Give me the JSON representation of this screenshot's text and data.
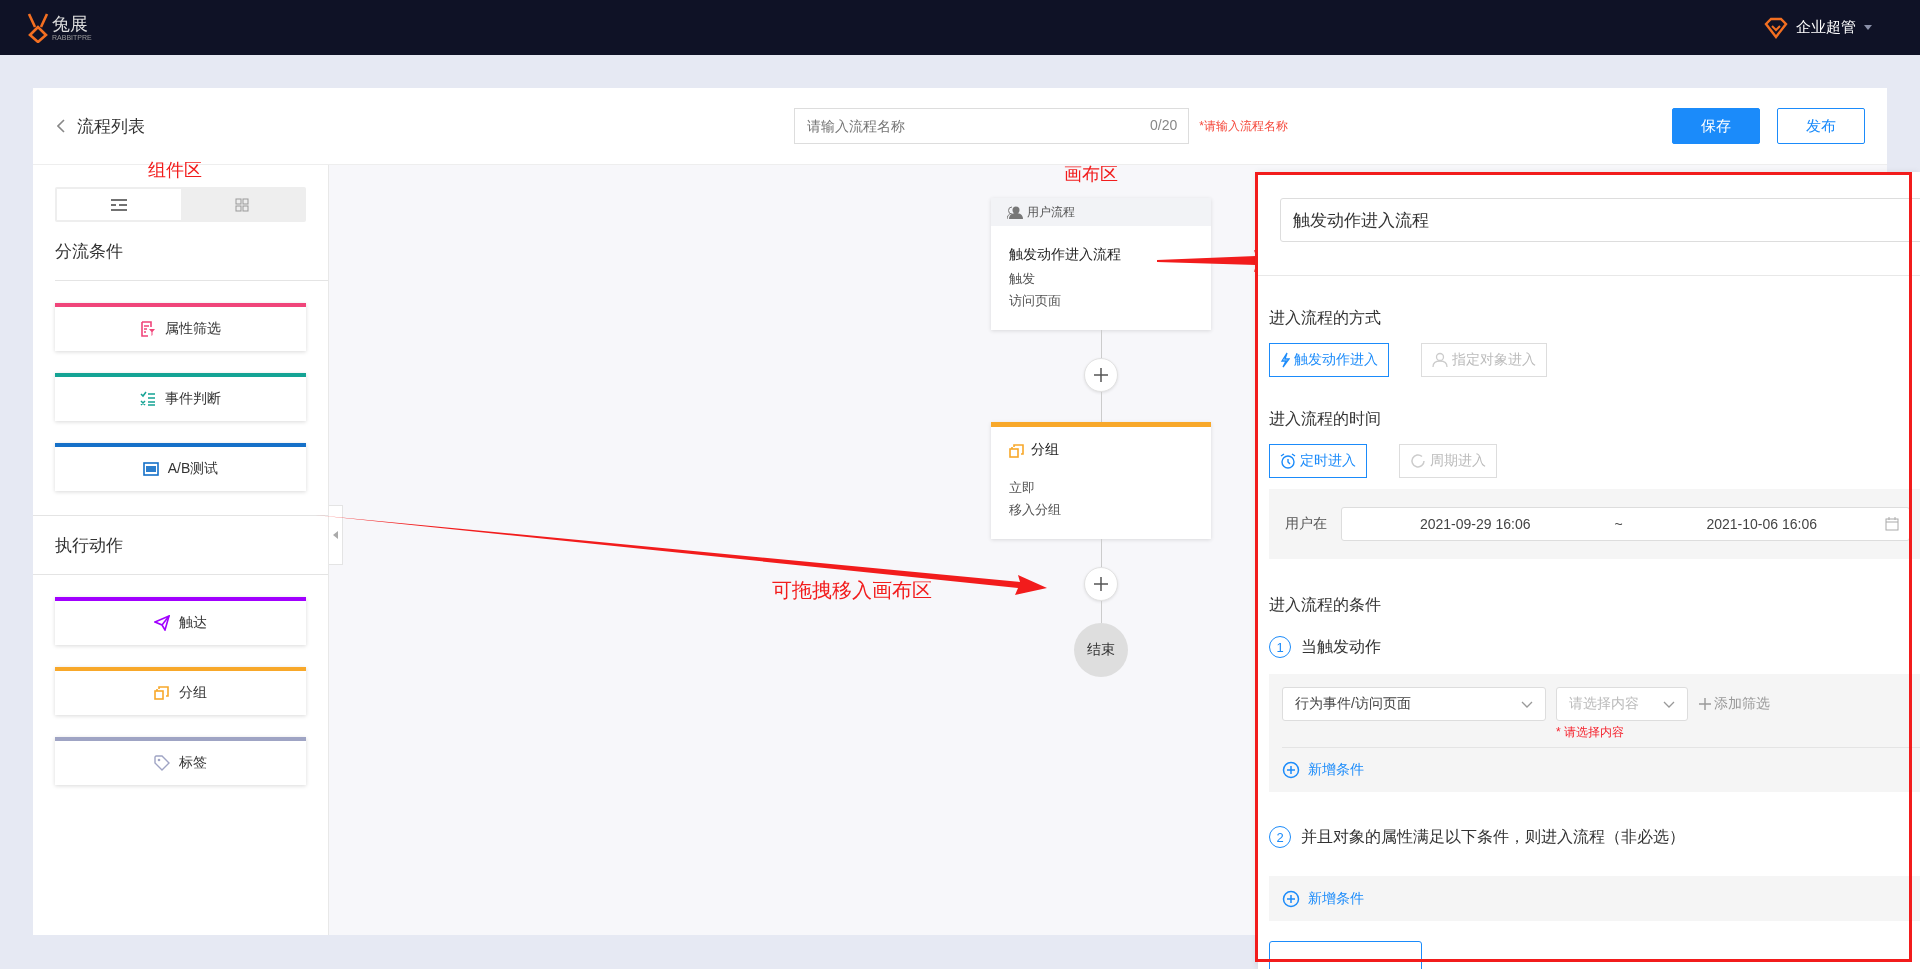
{
  "top_bar": {
    "logo_text": "兔展",
    "logo_subtext": "RABBITPRE",
    "user": "企业超管"
  },
  "header": {
    "back_label": "流程列表",
    "name_field": {
      "placeholder": "请输入流程名称",
      "counter": "0/20"
    },
    "name_error": "*请输入流程名称",
    "buttons": [
      {
        "label": "保存",
        "kind": "primary"
      },
      {
        "label": "发布",
        "kind": "outline"
      }
    ]
  },
  "sidebar": {
    "view_toggle": [
      {
        "kind": "list",
        "selected": true
      },
      {
        "kind": "grid",
        "selected": false
      }
    ],
    "sections": [
      {
        "title": "分流条件",
        "items": [
          {
            "label": "属性筛选",
            "kind": "attribute",
            "color": "#f0457a"
          },
          {
            "label": "事件判断",
            "kind": "event",
            "color": "#14a394"
          },
          {
            "label": "A/B测试",
            "kind": "abtest",
            "color": "#1570c8"
          }
        ]
      },
      {
        "title": "执行动作",
        "items": [
          {
            "label": "触达",
            "kind": "reach",
            "color": "#a100ff"
          },
          {
            "label": "分组",
            "kind": "group",
            "color": "#f8a82a"
          },
          {
            "label": "标签",
            "kind": "tag",
            "color": "#9fa4c4"
          }
        ]
      }
    ]
  },
  "annotations": [
    {
      "text": "组件区",
      "kind": "components"
    },
    {
      "text": "画布区",
      "kind": "canvas"
    },
    {
      "text": "可拖拽移入画布区",
      "kind": "drag"
    }
  ],
  "canvas": {
    "nodes": [
      {
        "kind": "trigger",
        "header": "用户流程",
        "title": "触发动作进入流程",
        "lines": [
          "触发",
          "访问页面"
        ]
      },
      {
        "kind": "group",
        "title": "分组",
        "color": "#f8a82a",
        "lines": [
          "立即",
          "移入分组"
        ]
      }
    ],
    "end_label": "结束"
  },
  "drawer": {
    "title_field": "触发动作进入流程",
    "entry_method": {
      "title": "进入流程的方式",
      "options": [
        {
          "label": "触发动作进入",
          "kind": "trigger",
          "selected": true
        },
        {
          "label": "指定对象进入",
          "kind": "audience",
          "selected": false
        }
      ]
    },
    "entry_time": {
      "title": "进入流程的时间",
      "options": [
        {
          "label": "定时进入",
          "kind": "scheduled",
          "selected": true
        },
        {
          "label": "周期进入",
          "kind": "periodic",
          "selected": false
        }
      ],
      "range_label": "用户在",
      "start": "2021-09-29 16:06",
      "separator": "~",
      "end": "2021-10-06 16:06"
    },
    "conditions": {
      "title": "进入流程的条件",
      "steps": [
        {
          "number": "1",
          "label": "当触发动作",
          "rows": [
            {
              "event": "行为事件/访问页面",
              "content_placeholder": "请选择内容",
              "add_filter": "添加筛选",
              "error": "* 请选择内容"
            }
          ],
          "add_label": "新增条件"
        },
        {
          "number": "2",
          "label": "并且对象的属性满足以下条件，则进入流程（非必选）",
          "add_label": "新增条件"
        }
      ]
    }
  }
}
